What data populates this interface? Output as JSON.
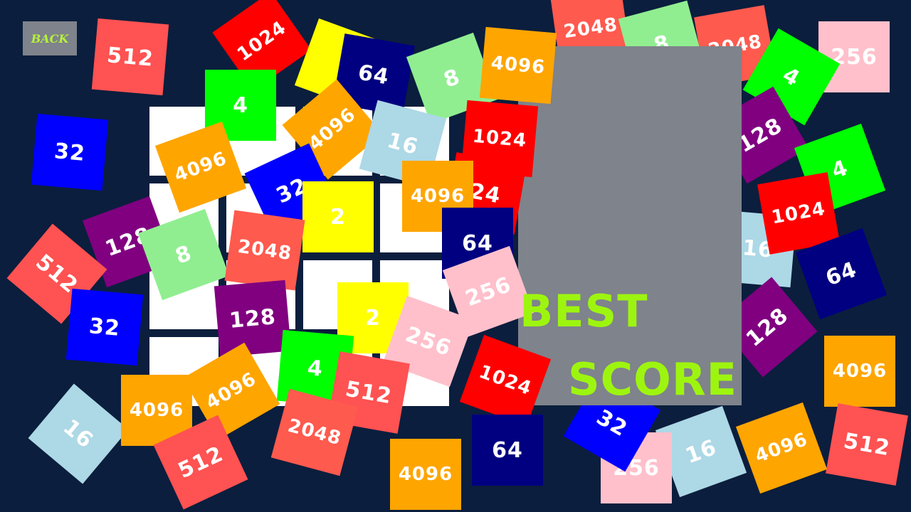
{
  "back_button": {
    "label": "BACK"
  },
  "score_panel": {
    "best_label": "BEST",
    "score_label": "SCORE"
  },
  "colors": {
    "background": "#0b1e3d",
    "panel": "#7f838b",
    "accent": "#9df50f",
    "2": "#ffff00",
    "4": "#00ff00",
    "8": "#90ee90",
    "16": "#add8e6",
    "32": "#0000ff",
    "64": "#000080",
    "128": "#800080",
    "256": "#ffc0cb",
    "512": "#ff5252",
    "1024": "#ff0000",
    "2048": "#ff5a4e",
    "4096": "#ffa500"
  },
  "tiles_back": [
    {
      "v": "2048",
      "r": -8
    },
    {
      "v": "8",
      "r": -15
    },
    {
      "v": "2048",
      "r": -10
    },
    {
      "v": "256",
      "r": 0
    },
    {
      "v": "4",
      "r": 30
    },
    {
      "v": "128",
      "r": -30
    },
    {
      "v": "4",
      "r": -20
    },
    {
      "v": "16",
      "r": 5
    },
    {
      "v": "1024",
      "r": -10
    },
    {
      "v": "64",
      "r": -20
    },
    {
      "v": "128",
      "r": -40
    },
    {
      "v": "4096",
      "r": 0
    },
    {
      "v": "512",
      "r": 10
    },
    {
      "v": "16",
      "r": -20
    },
    {
      "v": "4096",
      "r": -20
    },
    {
      "v": "256",
      "r": 0
    },
    {
      "v": "32",
      "r": 30
    }
  ],
  "tiles_front": [
    {
      "v": "512",
      "r": 5
    },
    {
      "v": "1024",
      "r": -35
    },
    {
      "v": "",
      "r": 20
    },
    {
      "v": "64",
      "r": 10
    },
    {
      "v": "8",
      "r": -20
    },
    {
      "v": "4096",
      "r": 5
    },
    {
      "v": "4",
      "r": 0
    },
    {
      "v": "32",
      "r": 5
    },
    {
      "v": "4096",
      "r": -40
    },
    {
      "v": "16",
      "r": 15
    },
    {
      "v": "1024",
      "r": 5
    },
    {
      "v": "4096",
      "r": -20
    },
    {
      "v": "32",
      "r": -25
    },
    {
      "v": "2",
      "r": 0
    },
    {
      "v": "24",
      "r": 10
    },
    {
      "v": "4096",
      "r": 0
    },
    {
      "v": "128",
      "r": -20
    },
    {
      "v": "8",
      "r": -20
    },
    {
      "v": "2048",
      "r": 8
    },
    {
      "v": "512",
      "r": 40
    },
    {
      "v": "64",
      "r": 0
    },
    {
      "v": "256",
      "r": -20
    },
    {
      "v": "32",
      "r": 5
    },
    {
      "v": "128",
      "r": -5
    },
    {
      "v": "2",
      "r": 0
    },
    {
      "v": "256",
      "r": 20
    },
    {
      "v": "4",
      "r": 5
    },
    {
      "v": "1024",
      "r": 20
    },
    {
      "v": "4096",
      "r": -30
    },
    {
      "v": "16",
      "r": 40
    },
    {
      "v": "4096",
      "r": 0
    },
    {
      "v": "512",
      "r": -25
    },
    {
      "v": "512",
      "r": 10
    },
    {
      "v": "2048",
      "r": 15
    },
    {
      "v": "4096",
      "r": 0
    },
    {
      "v": "64",
      "r": 0
    }
  ]
}
